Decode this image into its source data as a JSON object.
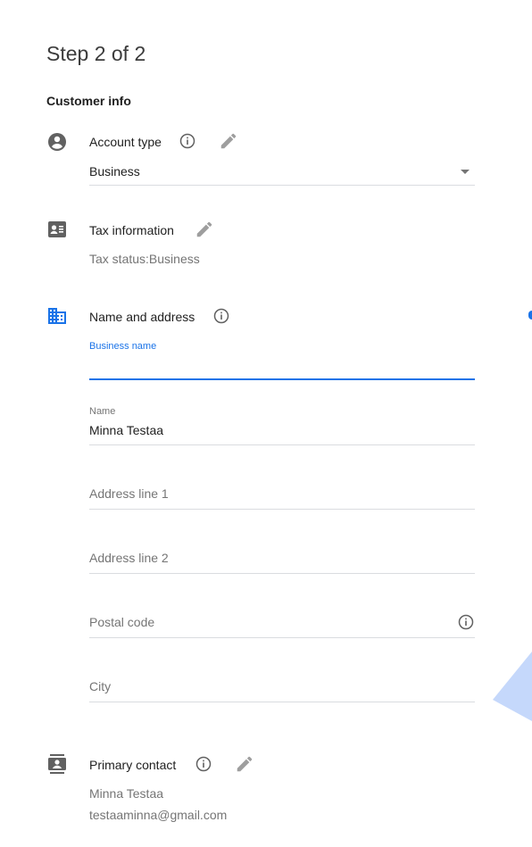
{
  "header": {
    "step": "Step 2 of 2"
  },
  "section": {
    "title": "Customer info"
  },
  "account_type": {
    "label": "Account type",
    "icon": "account-circle-icon",
    "selected": "Business"
  },
  "tax_information": {
    "label": "Tax information",
    "icon": "contact-card-icon",
    "status_label": "Tax status",
    "status_value": "Business"
  },
  "name_and_address": {
    "label": "Name and address",
    "icon": "domain-icon",
    "accent_color": "#1a73e8",
    "business_name": {
      "label": "Business name",
      "value": ""
    },
    "name": {
      "label": "Name",
      "value": "Minna Testaa"
    },
    "address_line_1": {
      "placeholder": "Address line 1"
    },
    "address_line_2": {
      "placeholder": "Address line 2"
    },
    "postal_code": {
      "placeholder": "Postal code"
    },
    "city": {
      "placeholder": "City"
    }
  },
  "primary_contact": {
    "label": "Primary contact",
    "icon": "contact-badge-icon",
    "name": "Minna Testaa",
    "email": "testaaminna@gmail.com"
  }
}
